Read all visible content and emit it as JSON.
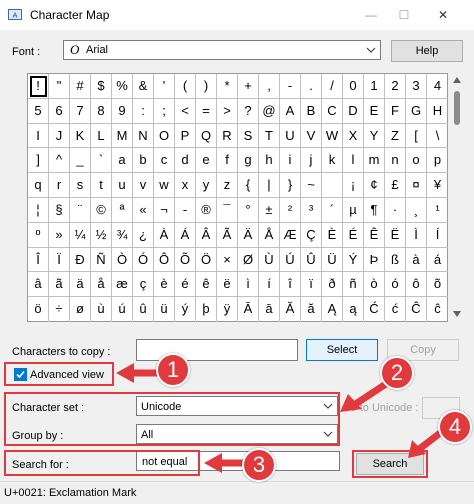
{
  "window": {
    "title": "Character Map",
    "minimize": "—",
    "maximize": "☐",
    "close": "✕"
  },
  "font": {
    "label": "Font :",
    "glyph": "O",
    "value": "Arial",
    "help_label": "Help"
  },
  "grid": {
    "selected_index": 0,
    "rows": [
      [
        "!",
        "\"",
        "#",
        "$",
        "%",
        "&",
        "'",
        "(",
        ")",
        "*",
        "+",
        ",",
        "-",
        ".",
        "/",
        "0",
        "1",
        "2",
        "3",
        "4"
      ],
      [
        "5",
        "6",
        "7",
        "8",
        "9",
        ":",
        ";",
        "<",
        "=",
        ">",
        "?",
        "@",
        "A",
        "B",
        "C",
        "D",
        "E",
        "F",
        "G",
        "H"
      ],
      [
        "I",
        "J",
        "K",
        "L",
        "M",
        "N",
        "O",
        "P",
        "Q",
        "R",
        "S",
        "T",
        "U",
        "V",
        "W",
        "X",
        "Y",
        "Z",
        "[",
        "\\"
      ],
      [
        "]",
        "^",
        "_",
        "`",
        "a",
        "b",
        "c",
        "d",
        "e",
        "f",
        "g",
        "h",
        "i",
        "j",
        "k",
        "l",
        "m",
        "n",
        "o",
        "p"
      ],
      [
        "q",
        "r",
        "s",
        "t",
        "u",
        "v",
        "w",
        "x",
        "y",
        "z",
        "{",
        "|",
        "}",
        "~",
        " ",
        "¡",
        "¢",
        "£",
        "¤",
        "¥"
      ],
      [
        "¦",
        "§",
        "¨",
        "©",
        "ª",
        "«",
        "¬",
        "-",
        "®",
        "¯",
        "°",
        "±",
        "²",
        "³",
        "´",
        "µ",
        "¶",
        "·",
        "¸",
        "¹"
      ],
      [
        "º",
        "»",
        "¼",
        "½",
        "¾",
        "¿",
        "À",
        "Á",
        "Â",
        "Ã",
        "Ä",
        "Å",
        "Æ",
        "Ç",
        "È",
        "É",
        "Ê",
        "Ë",
        "Ì",
        "Í"
      ],
      [
        "Î",
        "Ï",
        "Ð",
        "Ñ",
        "Ò",
        "Ó",
        "Ô",
        "Õ",
        "Ö",
        "×",
        "Ø",
        "Ù",
        "Ú",
        "Û",
        "Ü",
        "Ý",
        "Þ",
        "ß",
        "à",
        "á"
      ],
      [
        "â",
        "ã",
        "ä",
        "å",
        "æ",
        "ç",
        "è",
        "é",
        "ê",
        "ë",
        "ì",
        "í",
        "î",
        "ï",
        "ð",
        "ñ",
        "ò",
        "ó",
        "ô",
        "õ"
      ],
      [
        "ö",
        "÷",
        "ø",
        "ù",
        "ú",
        "û",
        "ü",
        "ý",
        "þ",
        "ÿ",
        "Ā",
        "ā",
        "Ă",
        "ă",
        "Ą",
        "ą",
        "Ć",
        "ć",
        "Ĉ",
        "ĉ"
      ]
    ]
  },
  "copy": {
    "label": "Characters to copy :",
    "value": "",
    "select_label": "Select",
    "copy_label": "Copy"
  },
  "advanced": {
    "label": "Advanced view",
    "checked": true
  },
  "charset": {
    "label": "Character set :",
    "value": "Unicode"
  },
  "goto": {
    "label": "Go to Unicode :",
    "value": ""
  },
  "groupby": {
    "label": "Group by :",
    "value": "All"
  },
  "search": {
    "label": "Search for :",
    "value": "not equal",
    "button_label": "Search"
  },
  "status": {
    "text": "U+0021: Exclamation Mark"
  },
  "callouts": [
    "1",
    "2",
    "3",
    "4"
  ],
  "colors": {
    "annotation_red": "#e0393e",
    "accent_blue": "#0078d7"
  }
}
